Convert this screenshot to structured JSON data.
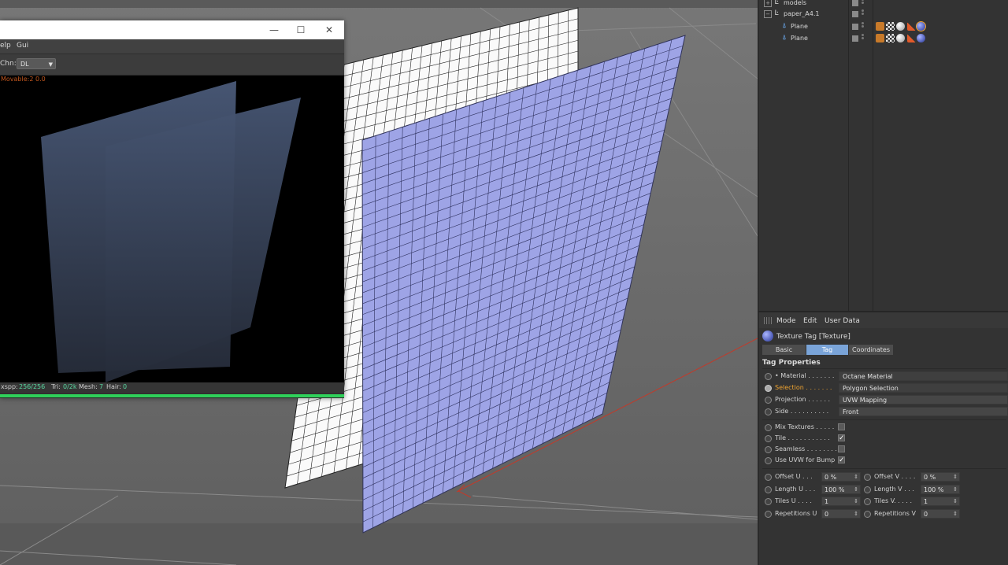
{
  "render_window": {
    "menu_items": [
      "elp",
      "Gui"
    ],
    "chn_label": "Chn:",
    "chn_value": "DL",
    "status_line": "Movable:2  0.0",
    "stats": {
      "spp_label": "xspp:",
      "spp_value": "256/256",
      "tri_label": "Tri:",
      "tri_value": "0/2k",
      "mesh_label": "Mesh:",
      "mesh_value": "7",
      "hair_label": "Hair:",
      "hair_value": "0"
    },
    "progress": 1.0,
    "progress_color": "#2fd15a"
  },
  "object_manager": {
    "rows": [
      {
        "name": "models"
      },
      {
        "name": "paper_A4.1"
      },
      {
        "name": "Plane"
      },
      {
        "name": "Plane"
      }
    ]
  },
  "attribute_manager": {
    "menu": [
      "Mode",
      "Edit",
      "User Data"
    ],
    "title": "Texture Tag [Texture]",
    "tabs": [
      "Basic",
      "Tag",
      "Coordinates"
    ],
    "active_tab": "Tag",
    "section": "Tag Properties",
    "props": [
      {
        "label": "Material . . . . . . .",
        "value": "Octane Material"
      },
      {
        "label": "Selection . . . . . . .",
        "value": "Polygon Selection"
      },
      {
        "label": "Projection . . . . . .",
        "value": "UVW Mapping"
      },
      {
        "label": "Side . . . . . . . . . .",
        "value": "Front"
      }
    ],
    "checks": [
      {
        "label": "Mix Textures . . . . .",
        "checked": false
      },
      {
        "label": "Tile . . . . . . . . . . .",
        "checked": true,
        "mark": "✓"
      },
      {
        "label": "Seamless . . . . . . . .",
        "checked": false
      },
      {
        "label": "Use UVW for Bump",
        "checked": true,
        "mark": "✓"
      }
    ],
    "numeric": [
      {
        "l_label": "Offset U . . .",
        "l_value": "0 %",
        "r_label": "Offset V . . . .",
        "r_value": "0 %"
      },
      {
        "l_label": "Length U . . .",
        "l_value": "100 %",
        "r_label": "Length V . . .",
        "r_value": "100 %"
      },
      {
        "l_label": "Tiles U . . . .",
        "l_value": "1",
        "r_label": "Tiles V. . . . .",
        "r_value": "1"
      },
      {
        "l_label": "Repetitions U",
        "l_value": "0",
        "r_label": "Repetitions V",
        "r_value": "0"
      }
    ],
    "spin_glyph": "⇕"
  }
}
